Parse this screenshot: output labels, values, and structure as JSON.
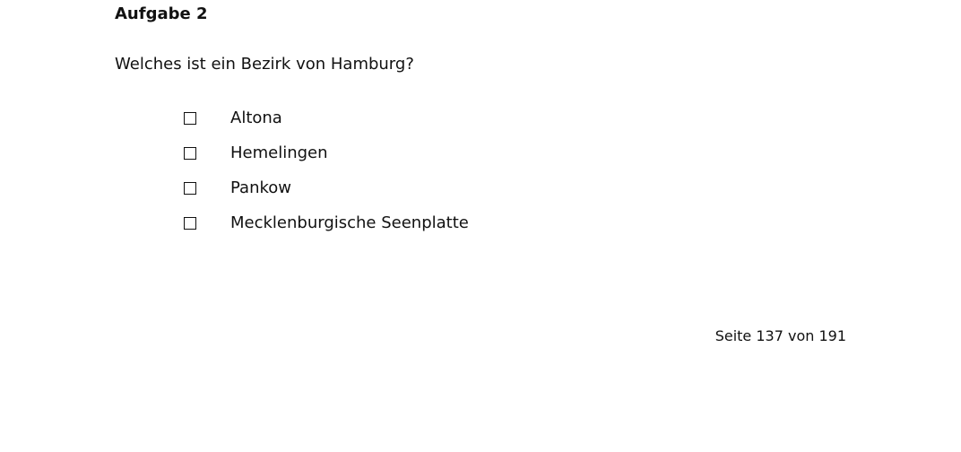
{
  "task": {
    "heading": "Aufgabe 2",
    "question": "Welches ist ein Bezirk von Hamburg?",
    "options": [
      {
        "label": "Altona"
      },
      {
        "label": "Hemelingen"
      },
      {
        "label": "Pankow"
      },
      {
        "label": "Mecklenburgische Seenplatte"
      }
    ]
  },
  "footer": {
    "page_label": "Seite 137 von 191"
  }
}
